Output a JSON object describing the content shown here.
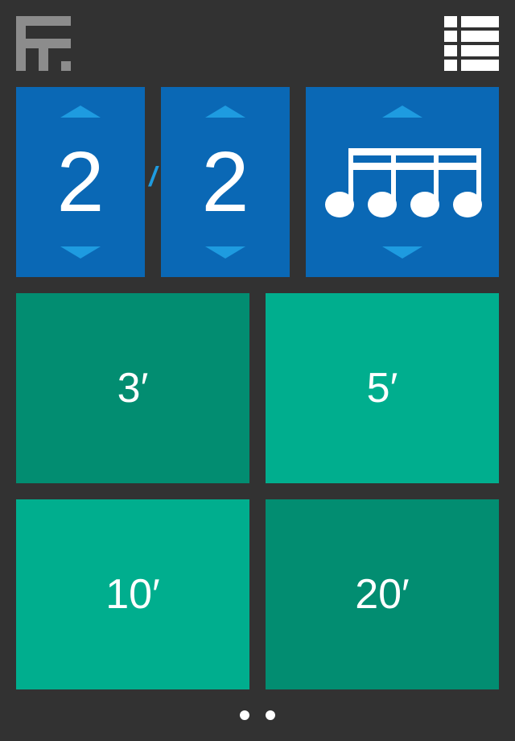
{
  "header": {
    "logo_icon": "app-logo-icon",
    "menu_icon": "list-menu-icon"
  },
  "time_signature": {
    "numerator": "2",
    "separator": "/",
    "denominator": "2",
    "subdivision_icon": "four-sixteenth-notes-icon"
  },
  "durations": [
    {
      "label": "3′"
    },
    {
      "label": "5′"
    },
    {
      "label": "10′"
    },
    {
      "label": "20′"
    }
  ],
  "pager": {
    "pages": 2
  },
  "colors": {
    "background": "#323232",
    "panel_blue": "#0a68b5",
    "arrow_blue": "#1e9be0",
    "tile_dark": "#028d71",
    "tile_light": "#00ae8e"
  }
}
